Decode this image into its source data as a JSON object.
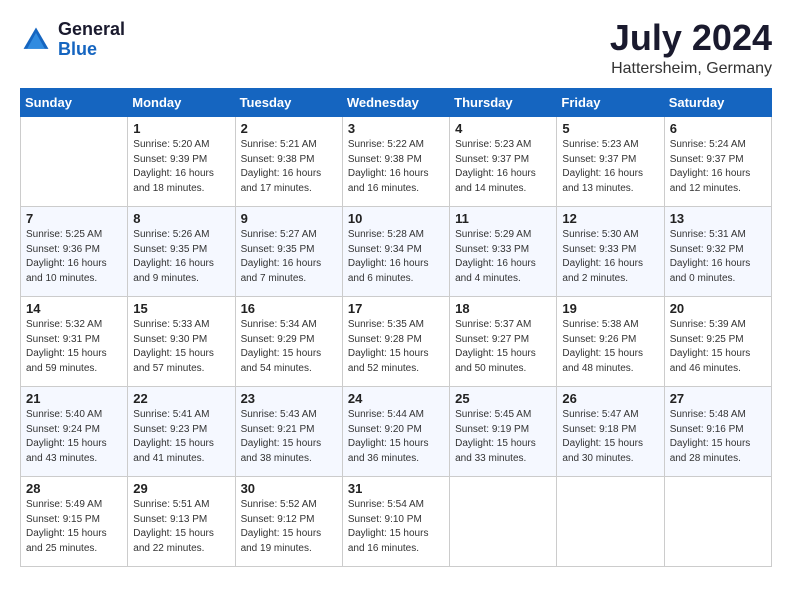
{
  "header": {
    "logo_general": "General",
    "logo_blue": "Blue",
    "month_title": "July 2024",
    "location": "Hattersheim, Germany"
  },
  "weekdays": [
    "Sunday",
    "Monday",
    "Tuesday",
    "Wednesday",
    "Thursday",
    "Friday",
    "Saturday"
  ],
  "weeks": [
    [
      {
        "day": "",
        "info": ""
      },
      {
        "day": "1",
        "info": "Sunrise: 5:20 AM\nSunset: 9:39 PM\nDaylight: 16 hours\nand 18 minutes."
      },
      {
        "day": "2",
        "info": "Sunrise: 5:21 AM\nSunset: 9:38 PM\nDaylight: 16 hours\nand 17 minutes."
      },
      {
        "day": "3",
        "info": "Sunrise: 5:22 AM\nSunset: 9:38 PM\nDaylight: 16 hours\nand 16 minutes."
      },
      {
        "day": "4",
        "info": "Sunrise: 5:23 AM\nSunset: 9:37 PM\nDaylight: 16 hours\nand 14 minutes."
      },
      {
        "day": "5",
        "info": "Sunrise: 5:23 AM\nSunset: 9:37 PM\nDaylight: 16 hours\nand 13 minutes."
      },
      {
        "day": "6",
        "info": "Sunrise: 5:24 AM\nSunset: 9:37 PM\nDaylight: 16 hours\nand 12 minutes."
      }
    ],
    [
      {
        "day": "7",
        "info": "Sunrise: 5:25 AM\nSunset: 9:36 PM\nDaylight: 16 hours\nand 10 minutes."
      },
      {
        "day": "8",
        "info": "Sunrise: 5:26 AM\nSunset: 9:35 PM\nDaylight: 16 hours\nand 9 minutes."
      },
      {
        "day": "9",
        "info": "Sunrise: 5:27 AM\nSunset: 9:35 PM\nDaylight: 16 hours\nand 7 minutes."
      },
      {
        "day": "10",
        "info": "Sunrise: 5:28 AM\nSunset: 9:34 PM\nDaylight: 16 hours\nand 6 minutes."
      },
      {
        "day": "11",
        "info": "Sunrise: 5:29 AM\nSunset: 9:33 PM\nDaylight: 16 hours\nand 4 minutes."
      },
      {
        "day": "12",
        "info": "Sunrise: 5:30 AM\nSunset: 9:33 PM\nDaylight: 16 hours\nand 2 minutes."
      },
      {
        "day": "13",
        "info": "Sunrise: 5:31 AM\nSunset: 9:32 PM\nDaylight: 16 hours\nand 0 minutes."
      }
    ],
    [
      {
        "day": "14",
        "info": "Sunrise: 5:32 AM\nSunset: 9:31 PM\nDaylight: 15 hours\nand 59 minutes."
      },
      {
        "day": "15",
        "info": "Sunrise: 5:33 AM\nSunset: 9:30 PM\nDaylight: 15 hours\nand 57 minutes."
      },
      {
        "day": "16",
        "info": "Sunrise: 5:34 AM\nSunset: 9:29 PM\nDaylight: 15 hours\nand 54 minutes."
      },
      {
        "day": "17",
        "info": "Sunrise: 5:35 AM\nSunset: 9:28 PM\nDaylight: 15 hours\nand 52 minutes."
      },
      {
        "day": "18",
        "info": "Sunrise: 5:37 AM\nSunset: 9:27 PM\nDaylight: 15 hours\nand 50 minutes."
      },
      {
        "day": "19",
        "info": "Sunrise: 5:38 AM\nSunset: 9:26 PM\nDaylight: 15 hours\nand 48 minutes."
      },
      {
        "day": "20",
        "info": "Sunrise: 5:39 AM\nSunset: 9:25 PM\nDaylight: 15 hours\nand 46 minutes."
      }
    ],
    [
      {
        "day": "21",
        "info": "Sunrise: 5:40 AM\nSunset: 9:24 PM\nDaylight: 15 hours\nand 43 minutes."
      },
      {
        "day": "22",
        "info": "Sunrise: 5:41 AM\nSunset: 9:23 PM\nDaylight: 15 hours\nand 41 minutes."
      },
      {
        "day": "23",
        "info": "Sunrise: 5:43 AM\nSunset: 9:21 PM\nDaylight: 15 hours\nand 38 minutes."
      },
      {
        "day": "24",
        "info": "Sunrise: 5:44 AM\nSunset: 9:20 PM\nDaylight: 15 hours\nand 36 minutes."
      },
      {
        "day": "25",
        "info": "Sunrise: 5:45 AM\nSunset: 9:19 PM\nDaylight: 15 hours\nand 33 minutes."
      },
      {
        "day": "26",
        "info": "Sunrise: 5:47 AM\nSunset: 9:18 PM\nDaylight: 15 hours\nand 30 minutes."
      },
      {
        "day": "27",
        "info": "Sunrise: 5:48 AM\nSunset: 9:16 PM\nDaylight: 15 hours\nand 28 minutes."
      }
    ],
    [
      {
        "day": "28",
        "info": "Sunrise: 5:49 AM\nSunset: 9:15 PM\nDaylight: 15 hours\nand 25 minutes."
      },
      {
        "day": "29",
        "info": "Sunrise: 5:51 AM\nSunset: 9:13 PM\nDaylight: 15 hours\nand 22 minutes."
      },
      {
        "day": "30",
        "info": "Sunrise: 5:52 AM\nSunset: 9:12 PM\nDaylight: 15 hours\nand 19 minutes."
      },
      {
        "day": "31",
        "info": "Sunrise: 5:54 AM\nSunset: 9:10 PM\nDaylight: 15 hours\nand 16 minutes."
      },
      {
        "day": "",
        "info": ""
      },
      {
        "day": "",
        "info": ""
      },
      {
        "day": "",
        "info": ""
      }
    ]
  ]
}
